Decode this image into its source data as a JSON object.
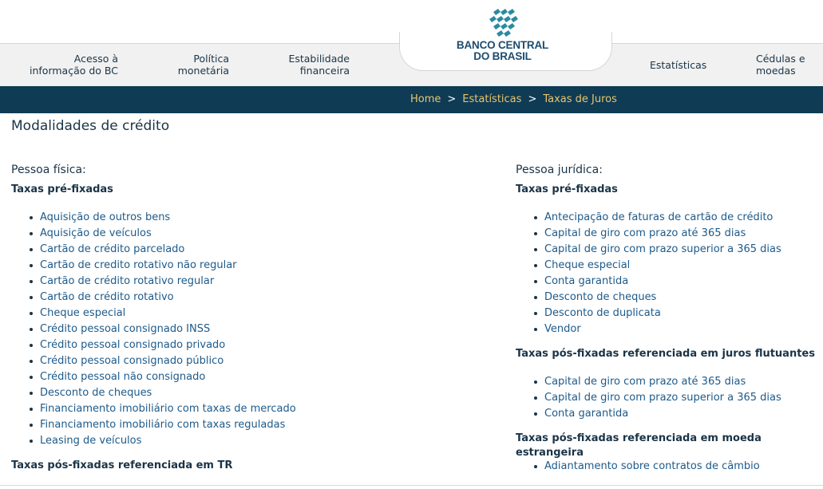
{
  "header": {
    "logo_line1": "BANCO CENTRAL",
    "logo_line2": "DO BRASIL",
    "nav": {
      "acesso_1": "Acesso à",
      "acesso_2": "informação do BC",
      "politica_1": "Política",
      "politica_2": "monetária",
      "estabilidade_1": "Estabilidade",
      "estabilidade_2": "financeira",
      "estatisticas": "Estatísticas",
      "cedulas_1": "Cédulas e",
      "cedulas_2": "moedas"
    },
    "brand_color": "#1d4c6e",
    "logo_color": "#2a8ba0"
  },
  "breadcrumb": {
    "home": "Home",
    "sep": ">",
    "estatisticas": "Estatísticas",
    "current": "Taxas de Juros"
  },
  "page_title": "Modalidades de crédito",
  "pf": {
    "title": "Pessoa física:",
    "pre_title": "Taxas pré-fixadas",
    "pre_items": [
      "Aquisição de outros bens",
      "Aquisição de veículos",
      "Cartão de crédito parcelado",
      "Cartão de credito rotativo não regular",
      "Cartão de crédito rotativo regular",
      "Cartão de crédito rotativo",
      "Cheque especial",
      "Crédito pessoal consignado INSS",
      "Crédito pessoal consignado privado",
      "Crédito pessoal consignado público",
      "Crédito pessoal não consignado",
      "Desconto de cheques",
      "Financiamento imobiliário com taxas de mercado",
      "Financiamento imobiliário com taxas reguladas",
      "Leasing de veículos"
    ],
    "pos_tr_title": "Taxas pós-fixadas referenciada em TR"
  },
  "pj": {
    "title": "Pessoa jurídica:",
    "pre_title": "Taxas pré-fixadas",
    "pre_items": [
      "Antecipação de faturas de cartão de crédito",
      "Capital de giro com prazo até 365 dias",
      "Capital de giro com prazo superior a 365 dias",
      "Cheque especial",
      "Conta garantida",
      "Desconto de cheques",
      "Desconto de duplicata",
      "Vendor"
    ],
    "pos_juros_title": "Taxas pós-fixadas referenciada em juros flutuantes",
    "pos_juros_items": [
      "Capital de giro com prazo até 365 dias",
      "Capital de giro com prazo superior a 365 dias",
      "Conta garantida"
    ],
    "pos_moeda_title": "Taxas pós-fixadas referenciada em moeda estrangeira",
    "pos_moeda_items": [
      "Adiantamento sobre contratos de câmbio"
    ]
  },
  "colors": {
    "breadcrumb_bar": "#0f3b55",
    "breadcrumb_link": "#e9c56b",
    "link": "#1d5a8a"
  }
}
